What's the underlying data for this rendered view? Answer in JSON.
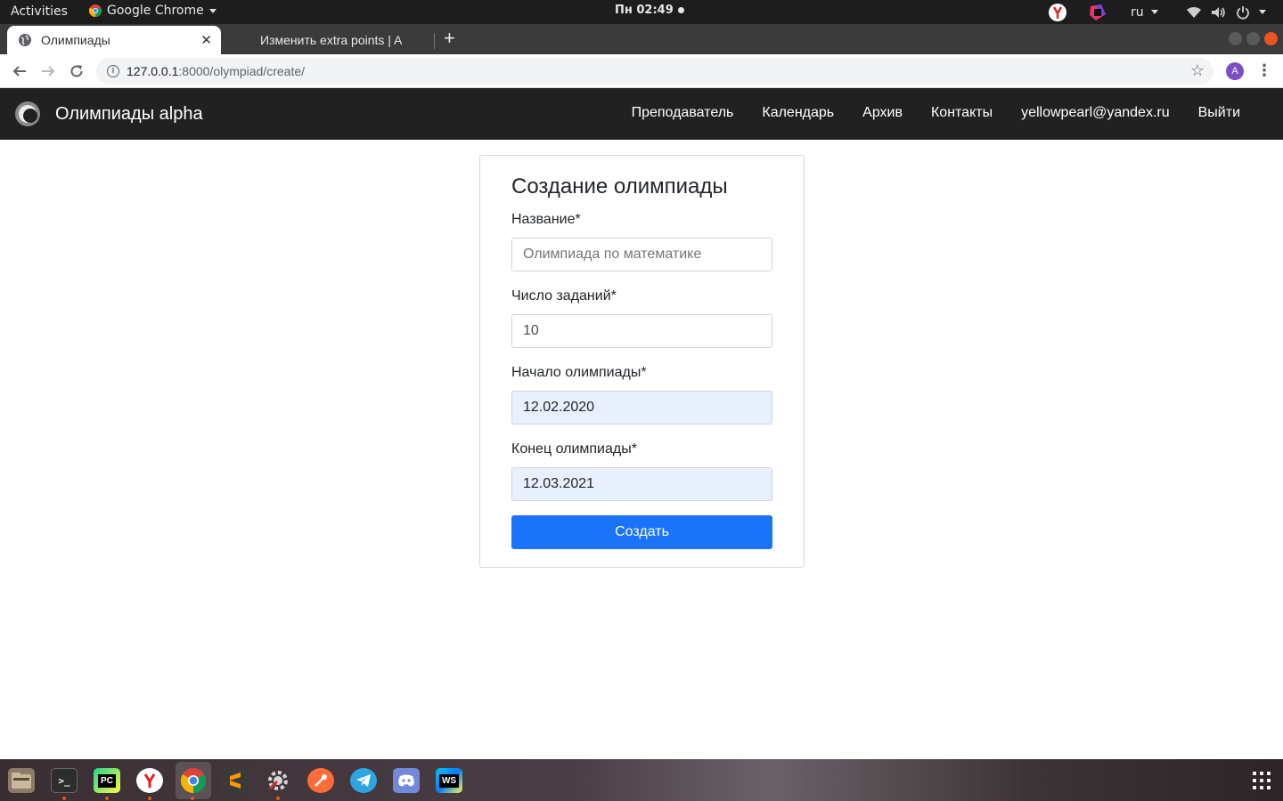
{
  "topbar": {
    "activities": "Activities",
    "app_name": "Google Chrome",
    "clock": "Пн 02:49",
    "lang": "ru"
  },
  "browser": {
    "tabs": [
      {
        "title": "Олимпиады",
        "active": true
      },
      {
        "title": "Изменить extra points | A",
        "active": false
      }
    ],
    "url_host": "127.0.0.1",
    "url_path": ":8000/olympiad/create/",
    "profile_initial": "A"
  },
  "site": {
    "brand": "Олимпиады alpha",
    "nav": [
      "Преподаватель",
      "Календарь",
      "Архив",
      "Контакты",
      "yellowpearl@yandex.ru",
      "Выйти"
    ]
  },
  "form": {
    "title": "Создание олимпиады",
    "name_label": "Название*",
    "name_placeholder": "Олимпиада по математике",
    "tasks_label": "Число заданий*",
    "tasks_value": "10",
    "start_label": "Начало олимпиады*",
    "start_value": "12.02.2020",
    "end_label": "Конец олимпиады*",
    "end_value": "12.03.2021",
    "submit_label": "Создать"
  },
  "dock": {
    "apps": [
      "files-icon",
      "terminal-icon",
      "pycharm-icon",
      "yandex-browser-icon",
      "chrome-icon",
      "sublime-icon",
      "settings-icon",
      "postman-icon",
      "telegram-icon",
      "discord-icon",
      "webstorm-icon"
    ],
    "pycharm_label": "PC",
    "webstorm_label": "WS"
  },
  "colors": {
    "navbar": "#212121",
    "primary": "#1a73f8",
    "autofill": "#e8f0fe"
  }
}
